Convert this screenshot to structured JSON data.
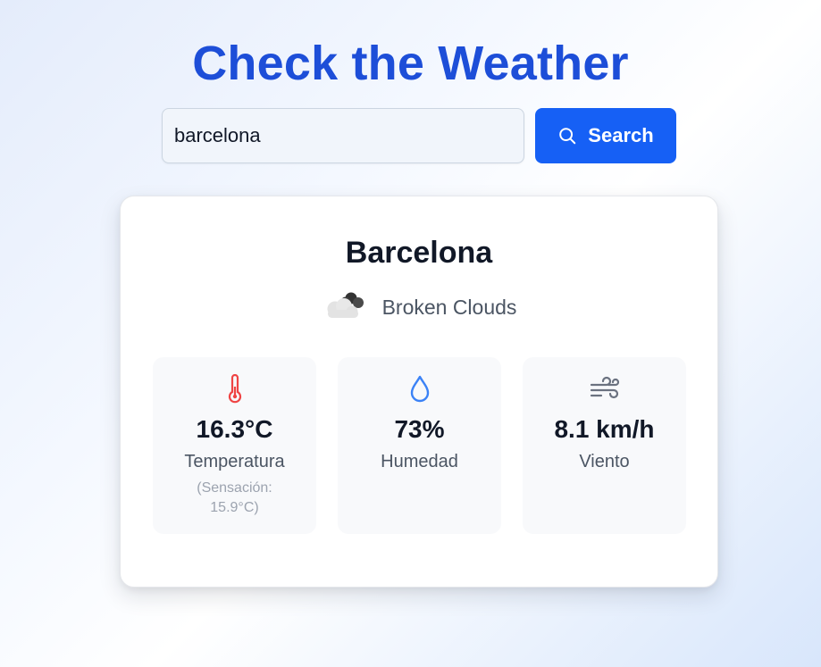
{
  "header": {
    "title": "Check the Weather"
  },
  "search": {
    "value": "barcelona",
    "button_label": "Search",
    "button_icon": "search-icon"
  },
  "weather": {
    "city": "Barcelona",
    "condition": "Broken Clouds",
    "condition_icon": "broken-clouds-icon",
    "stats": [
      {
        "icon": "thermometer-icon",
        "value": "16.3°C",
        "label": "Temperatura",
        "note": "(Sensación: 15.9°C)",
        "color": "#ef4444"
      },
      {
        "icon": "water-drop-icon",
        "value": "73%",
        "label": "Humedad",
        "color": "#3b82f6"
      },
      {
        "icon": "wind-icon",
        "value": "8.1 km/h",
        "label": "Viento",
        "color": "#6b7280"
      }
    ]
  },
  "colors": {
    "title": "#1d4ed8",
    "button": "#1660f5"
  }
}
